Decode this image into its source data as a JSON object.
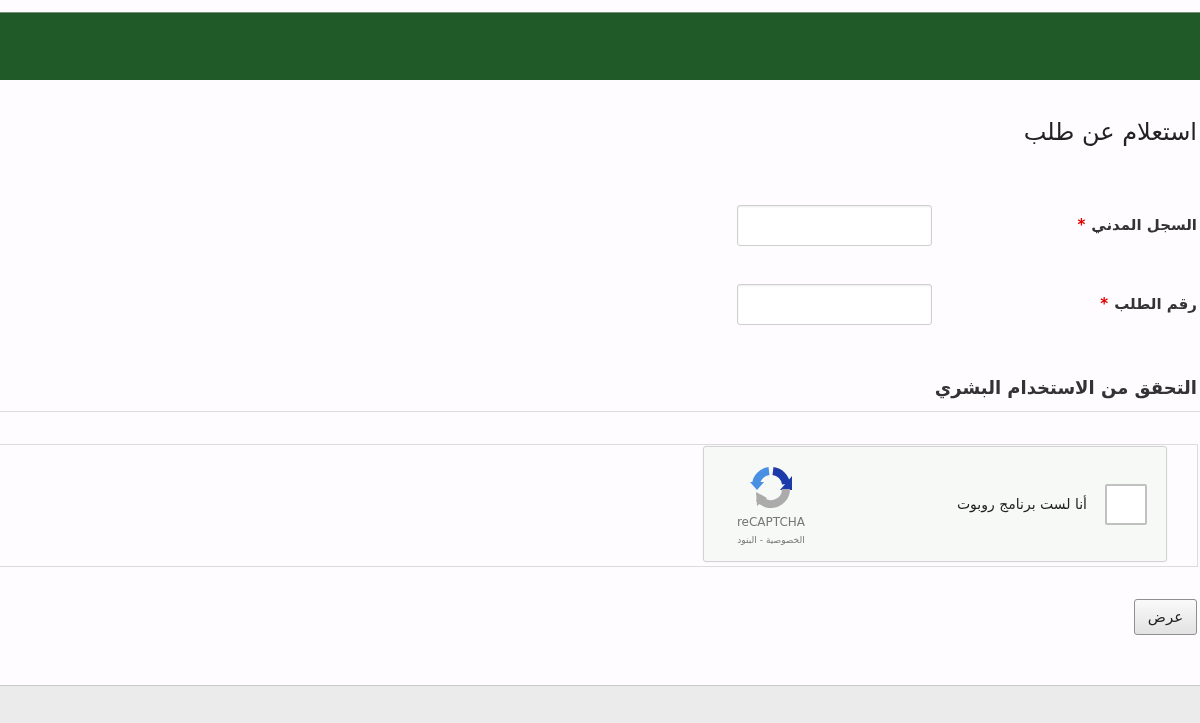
{
  "page_title": "استعلام عن طلب",
  "form": {
    "fields": [
      {
        "label": "السجل المدني",
        "marker": "*"
      },
      {
        "label": "رقم الطلب",
        "marker": "*"
      }
    ]
  },
  "captcha_section": {
    "heading": "التحقق من الاستخدام البشري",
    "widget": {
      "checked": false,
      "label": "أنا لست برنامج روبوت",
      "brand": "reCAPTCHA",
      "links": [
        "الخصوصية",
        "البنود"
      ],
      "link_separator": "-"
    }
  },
  "submit_button": "عرض"
}
